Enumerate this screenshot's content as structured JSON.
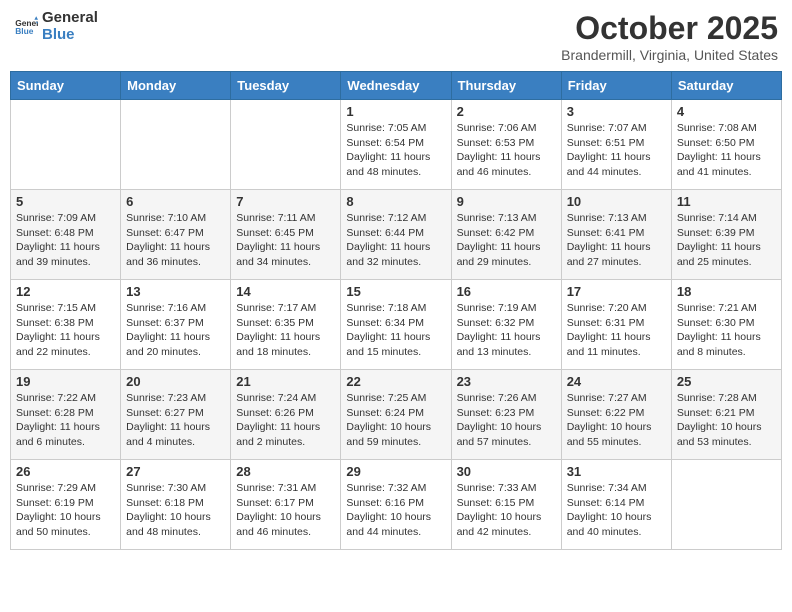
{
  "header": {
    "logo_general": "General",
    "logo_blue": "Blue",
    "month": "October 2025",
    "location": "Brandermill, Virginia, United States"
  },
  "weekdays": [
    "Sunday",
    "Monday",
    "Tuesday",
    "Wednesday",
    "Thursday",
    "Friday",
    "Saturday"
  ],
  "weeks": [
    [
      {
        "day": "",
        "info": ""
      },
      {
        "day": "",
        "info": ""
      },
      {
        "day": "",
        "info": ""
      },
      {
        "day": "1",
        "info": "Sunrise: 7:05 AM\nSunset: 6:54 PM\nDaylight: 11 hours\nand 48 minutes."
      },
      {
        "day": "2",
        "info": "Sunrise: 7:06 AM\nSunset: 6:53 PM\nDaylight: 11 hours\nand 46 minutes."
      },
      {
        "day": "3",
        "info": "Sunrise: 7:07 AM\nSunset: 6:51 PM\nDaylight: 11 hours\nand 44 minutes."
      },
      {
        "day": "4",
        "info": "Sunrise: 7:08 AM\nSunset: 6:50 PM\nDaylight: 11 hours\nand 41 minutes."
      }
    ],
    [
      {
        "day": "5",
        "info": "Sunrise: 7:09 AM\nSunset: 6:48 PM\nDaylight: 11 hours\nand 39 minutes."
      },
      {
        "day": "6",
        "info": "Sunrise: 7:10 AM\nSunset: 6:47 PM\nDaylight: 11 hours\nand 36 minutes."
      },
      {
        "day": "7",
        "info": "Sunrise: 7:11 AM\nSunset: 6:45 PM\nDaylight: 11 hours\nand 34 minutes."
      },
      {
        "day": "8",
        "info": "Sunrise: 7:12 AM\nSunset: 6:44 PM\nDaylight: 11 hours\nand 32 minutes."
      },
      {
        "day": "9",
        "info": "Sunrise: 7:13 AM\nSunset: 6:42 PM\nDaylight: 11 hours\nand 29 minutes."
      },
      {
        "day": "10",
        "info": "Sunrise: 7:13 AM\nSunset: 6:41 PM\nDaylight: 11 hours\nand 27 minutes."
      },
      {
        "day": "11",
        "info": "Sunrise: 7:14 AM\nSunset: 6:39 PM\nDaylight: 11 hours\nand 25 minutes."
      }
    ],
    [
      {
        "day": "12",
        "info": "Sunrise: 7:15 AM\nSunset: 6:38 PM\nDaylight: 11 hours\nand 22 minutes."
      },
      {
        "day": "13",
        "info": "Sunrise: 7:16 AM\nSunset: 6:37 PM\nDaylight: 11 hours\nand 20 minutes."
      },
      {
        "day": "14",
        "info": "Sunrise: 7:17 AM\nSunset: 6:35 PM\nDaylight: 11 hours\nand 18 minutes."
      },
      {
        "day": "15",
        "info": "Sunrise: 7:18 AM\nSunset: 6:34 PM\nDaylight: 11 hours\nand 15 minutes."
      },
      {
        "day": "16",
        "info": "Sunrise: 7:19 AM\nSunset: 6:32 PM\nDaylight: 11 hours\nand 13 minutes."
      },
      {
        "day": "17",
        "info": "Sunrise: 7:20 AM\nSunset: 6:31 PM\nDaylight: 11 hours\nand 11 minutes."
      },
      {
        "day": "18",
        "info": "Sunrise: 7:21 AM\nSunset: 6:30 PM\nDaylight: 11 hours\nand 8 minutes."
      }
    ],
    [
      {
        "day": "19",
        "info": "Sunrise: 7:22 AM\nSunset: 6:28 PM\nDaylight: 11 hours\nand 6 minutes."
      },
      {
        "day": "20",
        "info": "Sunrise: 7:23 AM\nSunset: 6:27 PM\nDaylight: 11 hours\nand 4 minutes."
      },
      {
        "day": "21",
        "info": "Sunrise: 7:24 AM\nSunset: 6:26 PM\nDaylight: 11 hours\nand 2 minutes."
      },
      {
        "day": "22",
        "info": "Sunrise: 7:25 AM\nSunset: 6:24 PM\nDaylight: 10 hours\nand 59 minutes."
      },
      {
        "day": "23",
        "info": "Sunrise: 7:26 AM\nSunset: 6:23 PM\nDaylight: 10 hours\nand 57 minutes."
      },
      {
        "day": "24",
        "info": "Sunrise: 7:27 AM\nSunset: 6:22 PM\nDaylight: 10 hours\nand 55 minutes."
      },
      {
        "day": "25",
        "info": "Sunrise: 7:28 AM\nSunset: 6:21 PM\nDaylight: 10 hours\nand 53 minutes."
      }
    ],
    [
      {
        "day": "26",
        "info": "Sunrise: 7:29 AM\nSunset: 6:19 PM\nDaylight: 10 hours\nand 50 minutes."
      },
      {
        "day": "27",
        "info": "Sunrise: 7:30 AM\nSunset: 6:18 PM\nDaylight: 10 hours\nand 48 minutes."
      },
      {
        "day": "28",
        "info": "Sunrise: 7:31 AM\nSunset: 6:17 PM\nDaylight: 10 hours\nand 46 minutes."
      },
      {
        "day": "29",
        "info": "Sunrise: 7:32 AM\nSunset: 6:16 PM\nDaylight: 10 hours\nand 44 minutes."
      },
      {
        "day": "30",
        "info": "Sunrise: 7:33 AM\nSunset: 6:15 PM\nDaylight: 10 hours\nand 42 minutes."
      },
      {
        "day": "31",
        "info": "Sunrise: 7:34 AM\nSunset: 6:14 PM\nDaylight: 10 hours\nand 40 minutes."
      },
      {
        "day": "",
        "info": ""
      }
    ]
  ]
}
